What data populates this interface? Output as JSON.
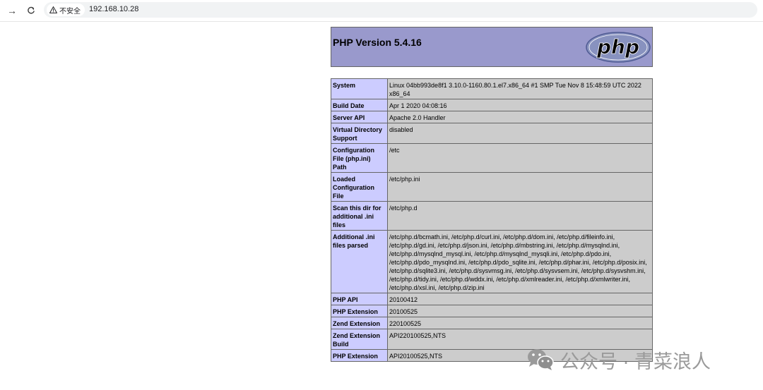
{
  "browser": {
    "security_label": "不安全",
    "url": "192.168.10.28"
  },
  "php": {
    "title": "PHP Version 5.4.16",
    "logo_text": "php",
    "rows": [
      {
        "key": "System",
        "value": "Linux 04bb993de8f1 3.10.0-1160.80.1.el7.x86_64 #1 SMP Tue Nov 8 15:48:59 UTC 2022 x86_64"
      },
      {
        "key": "Build Date",
        "value": "Apr 1 2020 04:08:16"
      },
      {
        "key": "Server API",
        "value": "Apache 2.0 Handler"
      },
      {
        "key": "Virtual Directory Support",
        "value": "disabled"
      },
      {
        "key": "Configuration File (php.ini) Path",
        "value": "/etc"
      },
      {
        "key": "Loaded Configuration File",
        "value": "/etc/php.ini"
      },
      {
        "key": "Scan this dir for additional .ini files",
        "value": "/etc/php.d"
      },
      {
        "key": "Additional .ini files parsed",
        "value": "/etc/php.d/bcmath.ini, /etc/php.d/curl.ini, /etc/php.d/dom.ini, /etc/php.d/fileinfo.ini, /etc/php.d/gd.ini, /etc/php.d/json.ini, /etc/php.d/mbstring.ini, /etc/php.d/mysqlnd.ini, /etc/php.d/mysqlnd_mysql.ini, /etc/php.d/mysqlnd_mysqli.ini, /etc/php.d/pdo.ini, /etc/php.d/pdo_mysqlnd.ini, /etc/php.d/pdo_sqlite.ini, /etc/php.d/phar.ini, /etc/php.d/posix.ini, /etc/php.d/sqlite3.ini, /etc/php.d/sysvmsg.ini, /etc/php.d/sysvsem.ini, /etc/php.d/sysvshm.ini, /etc/php.d/tidy.ini, /etc/php.d/wddx.ini, /etc/php.d/xmlreader.ini, /etc/php.d/xmlwriter.ini, /etc/php.d/xsl.ini, /etc/php.d/zip.ini"
      },
      {
        "key": "PHP API",
        "value": "20100412"
      },
      {
        "key": "PHP Extension",
        "value": "20100525"
      },
      {
        "key": "Zend Extension",
        "value": "220100525"
      },
      {
        "key": "Zend Extension Build",
        "value": "API220100525,NTS"
      },
      {
        "key": "PHP Extension",
        "value": "API20100525,NTS"
      }
    ]
  },
  "watermark": {
    "text": "公众号 · 青菜浪人"
  }
}
